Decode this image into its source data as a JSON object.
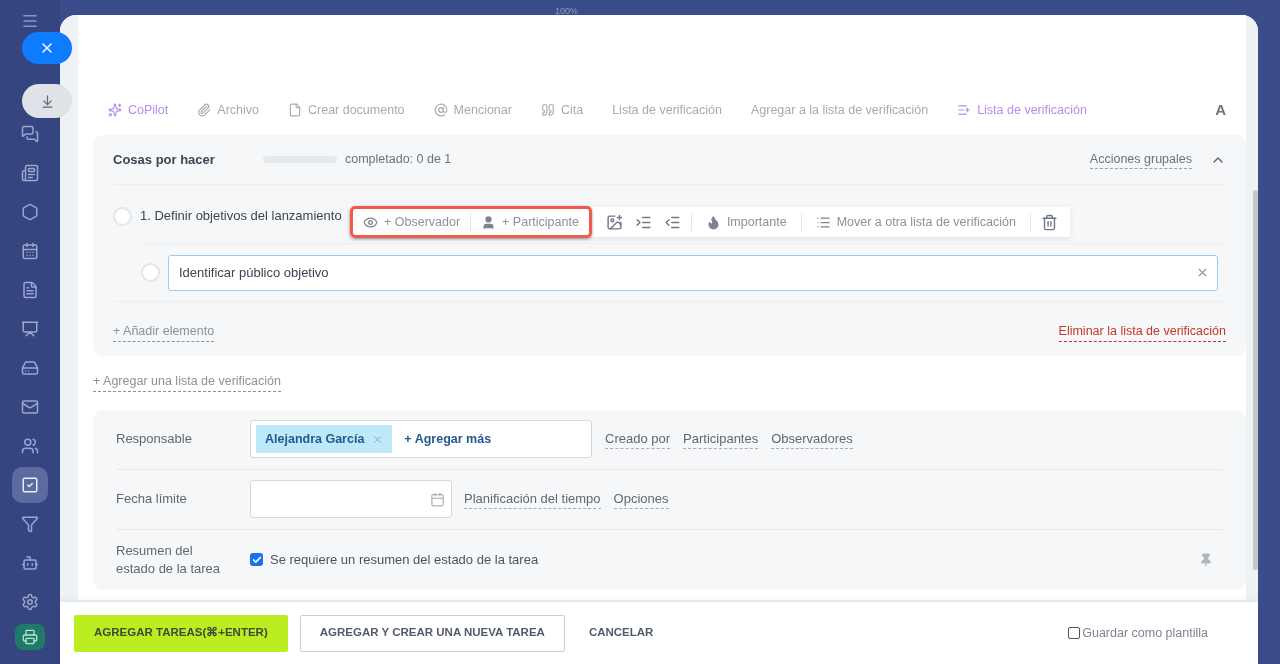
{
  "zoom_label": "100%",
  "sidebar": {
    "items": [
      {
        "selected": false
      },
      {
        "selected": false
      },
      {
        "selected": false
      },
      {
        "selected": false
      },
      {
        "selected": false
      },
      {
        "selected": false
      },
      {
        "selected": false
      },
      {
        "selected": false
      },
      {
        "selected": false
      },
      {
        "selected": true
      },
      {
        "selected": false
      },
      {
        "selected": false
      },
      {
        "selected": false
      }
    ]
  },
  "toolbar": {
    "items": [
      {
        "kind": "copilot",
        "label": "CoPilot",
        "active": true
      },
      {
        "kind": "file",
        "label": "Archivo",
        "active": false
      },
      {
        "kind": "document",
        "label": "Crear documento",
        "active": false
      },
      {
        "kind": "mention",
        "label": "Mencionar",
        "active": false
      },
      {
        "kind": "quote",
        "label": "Cita",
        "active": false
      },
      {
        "kind": "text",
        "label": "Lista de verificación",
        "active": false
      },
      {
        "kind": "text",
        "label": "Agregar a la lista de verificación",
        "active": false
      },
      {
        "kind": "checklist",
        "label": "Lista de verificación",
        "active": true
      }
    ],
    "format_button": "A"
  },
  "checklist": {
    "title": "Cosas por hacer",
    "level": 0,
    "progress_text": "completado: 0 de 1",
    "group_actions": "Acciones grupales",
    "expanded": true,
    "items": [
      {
        "label": "1. Definir objetivos del lanzamiento",
        "checked": false,
        "children": [
          {
            "value": "Identificar público objetivo",
            "checked": false
          }
        ]
      }
    ],
    "add_item": "+ Añadir elemento",
    "delete": "Eliminar la lista de verificación"
  },
  "item_toolbar": {
    "buttons": [
      {
        "kind": "observer",
        "label": "+ Observador",
        "highlighted": true
      },
      {
        "kind": "participant",
        "label": "+ Participante",
        "highlighted": true
      },
      {
        "kind": "attach",
        "highlighted": false
      },
      {
        "kind": "indent",
        "highlighted": false
      },
      {
        "kind": "outdent",
        "highlighted": false
      },
      {
        "kind": "important",
        "label": "Importante",
        "highlighted": false
      },
      {
        "kind": "move",
        "label": "Mover a otra lista de verificación",
        "highlighted": false
      },
      {
        "kind": "delete",
        "highlighted": false
      }
    ]
  },
  "add_checklist": "+ Agregar una lista de verificación",
  "form": {
    "responsible": {
      "label": "Responsable",
      "tags": [
        {
          "name": "Alejandra García"
        }
      ],
      "add_more": "+ Agregar más",
      "links": [
        "Creado por",
        "Participantes",
        "Observadores"
      ]
    },
    "deadline": {
      "label": "Fecha límite",
      "links": [
        "Planificación del tiempo",
        "Opciones"
      ]
    },
    "summary": {
      "label": "Resumen del estado de la tarea",
      "checkbox_label": "Se requiere un resumen del estado de la tarea",
      "checked": true
    }
  },
  "footer": {
    "buttons": [
      {
        "kind": "primary",
        "label": "AGREGAR TAREAS(⌘+ENTER)"
      },
      {
        "kind": "secondary",
        "label": "AGREGAR Y CREAR UNA NUEVA TAREA"
      },
      {
        "kind": "link",
        "label": "CANCELAR"
      }
    ],
    "save_template": {
      "label": "Guardar como plantilla",
      "checked": false
    }
  }
}
